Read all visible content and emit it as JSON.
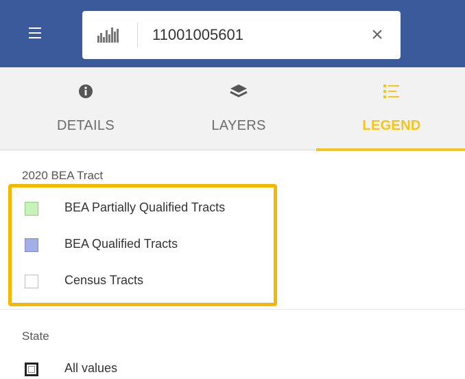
{
  "header": {
    "search": {
      "value": "11001005601",
      "clear_symbol": "×"
    }
  },
  "tabs": [
    {
      "label": "DETAILS",
      "icon": "info-circle-icon",
      "active": false
    },
    {
      "label": "LAYERS",
      "icon": "layers-icon",
      "active": false
    },
    {
      "label": "LEGEND",
      "icon": "list-icon",
      "active": true
    }
  ],
  "legend": {
    "groups": [
      {
        "title": "2020 BEA Tract",
        "items": [
          {
            "label": "BEA Partially Qualified Tracts",
            "color": "#c6f4b8",
            "border": "#8fcb7e"
          },
          {
            "label": "BEA Qualified Tracts",
            "color": "#a3aee6",
            "border": "#7e89c7"
          },
          {
            "label": "Census Tracts",
            "color": "#ffffff",
            "border": "#bdbdbd"
          }
        ]
      },
      {
        "title": "State",
        "items": [
          {
            "label": "All values",
            "color": "#ffffff",
            "border": "#222222"
          }
        ]
      }
    ]
  },
  "colors": {
    "header": "#3a5a9c",
    "accent": "#f5c518",
    "highlight": "#f5b800"
  }
}
